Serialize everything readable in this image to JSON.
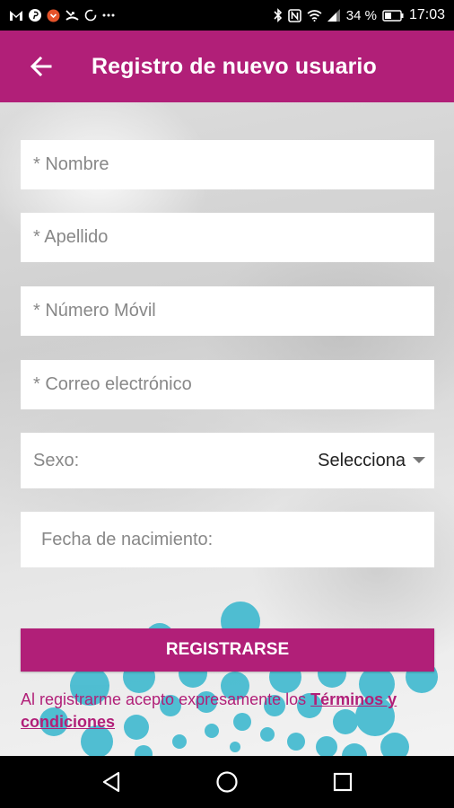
{
  "status_bar": {
    "battery_percent": "34 %",
    "time": "17:03",
    "left_icons": [
      "gmail-icon",
      "pinterest-icon",
      "notification-icon",
      "missed-call-icon",
      "sync-icon",
      "more-icon"
    ],
    "right_icons": [
      "bluetooth-icon",
      "nfc-icon",
      "wifi-icon",
      "signal-icon",
      "battery-icon"
    ]
  },
  "app_bar": {
    "title": "Registro de nuevo usuario",
    "back_icon": "arrow-back-icon"
  },
  "form": {
    "nombre_placeholder": "* Nombre",
    "apellido_placeholder": "* Apellido",
    "movil_placeholder": "* Número Móvil",
    "correo_placeholder": "* Correo electrónico",
    "sexo_label": "Sexo:",
    "sexo_value": "Selecciona",
    "fecha_label": "Fecha de nacimiento:"
  },
  "actions": {
    "register_label": "REGISTRARSE"
  },
  "terms": {
    "prefix": "Al registrarme acepto expresamente los ",
    "link": "Términos y condiciones"
  },
  "colors": {
    "accent": "#b11f78",
    "status_bar": "#000000",
    "decor_dots": "#3fb9cf"
  }
}
